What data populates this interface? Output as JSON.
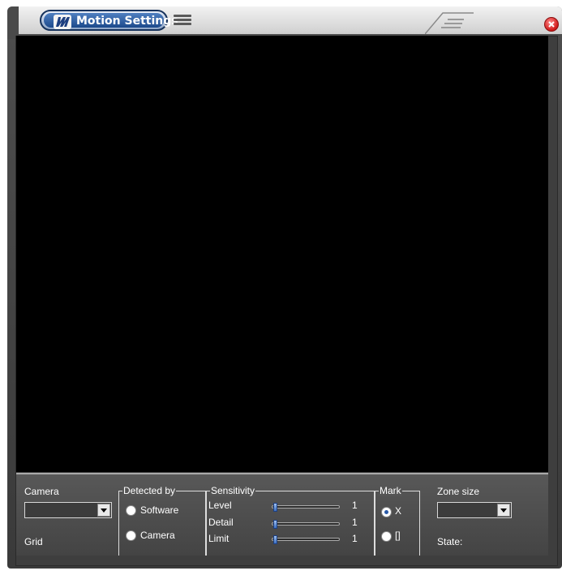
{
  "window": {
    "title": "Motion Settings"
  },
  "panel": {
    "camera": {
      "label": "Camera",
      "selected": ""
    },
    "grid_label": "Grid",
    "detected_by": {
      "title": "Detected by",
      "options": [
        "Software",
        "Camera"
      ],
      "selected": null
    },
    "sensitivity": {
      "title": "Sensitivity",
      "sliders": [
        {
          "label": "Level",
          "value": "1"
        },
        {
          "label": "Detail",
          "value": "1"
        },
        {
          "label": "Limit",
          "value": "1"
        }
      ]
    },
    "mark": {
      "title": "Mark",
      "options": [
        "X",
        "[]"
      ],
      "selected": "X"
    },
    "zone_size": {
      "label": "Zone size",
      "selected": ""
    },
    "state_label": "State:"
  },
  "colors": {
    "title_accent": "#1d4a8c",
    "close": "#d01818",
    "panel_bg": "#4e4e4e",
    "video_bg": "#000000"
  },
  "icons": [
    "app-logo-icon",
    "menu-icon",
    "close-icon",
    "dropdown-arrow-icon"
  ]
}
